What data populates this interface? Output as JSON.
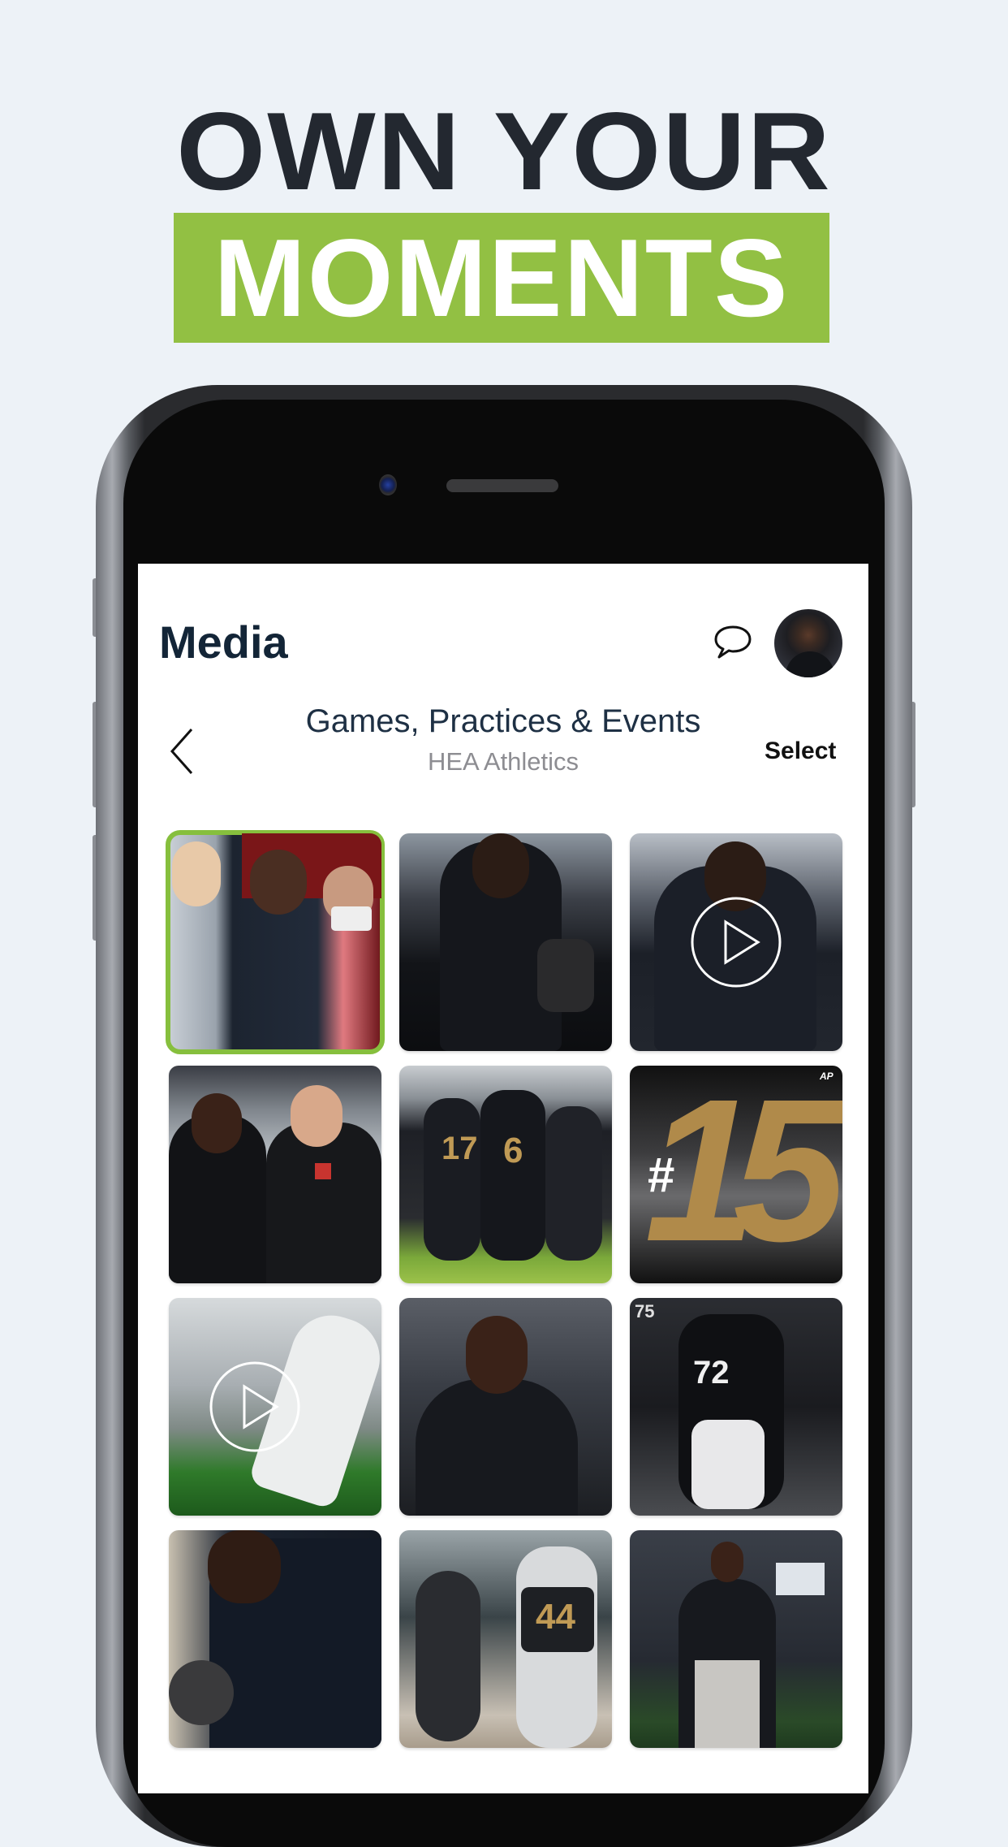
{
  "promo": {
    "headline_line1": "OWN YOUR",
    "headline_line2": "MOMENTS",
    "accent_color": "#92c043",
    "text_color": "#232830"
  },
  "app": {
    "title": "Media",
    "icons": {
      "messages": "chat-bubble-icon",
      "profile": "avatar"
    },
    "nav": {
      "back_icon": "chevron-left-icon",
      "album_title": "Games, Practices & Events",
      "album_subtitle": "HEA Athletics",
      "select_label": "Select"
    },
    "gallery": {
      "selected_index": 0,
      "selection_color": "#86bf3d",
      "items": [
        {
          "type": "photo",
          "description": "Group selfie with three people",
          "selected": true
        },
        {
          "type": "photo",
          "description": "Athlete lifting dumbbell in gym"
        },
        {
          "type": "video",
          "description": "Athlete looking at phone",
          "play_icon": "play-icon"
        },
        {
          "type": "photo",
          "description": "Two men laughing looking at phone"
        },
        {
          "type": "photo",
          "description": "Football players celebrating, jerseys 17 and 6"
        },
        {
          "type": "photo",
          "description": "Ranking graphic",
          "overlay_text": "#15",
          "badge_text": "AP"
        },
        {
          "type": "video",
          "description": "Football cleat on turf",
          "play_icon": "play-icon"
        },
        {
          "type": "photo",
          "description": "Athlete in black hoodie smiling"
        },
        {
          "type": "photo",
          "description": "Football team walking onto field, jersey 72"
        },
        {
          "type": "photo",
          "description": "Athlete lifting dumbbell close-up"
        },
        {
          "type": "photo",
          "description": "Football players at practice, jersey 44"
        },
        {
          "type": "photo",
          "description": "Athlete doing battle ropes"
        }
      ]
    }
  }
}
